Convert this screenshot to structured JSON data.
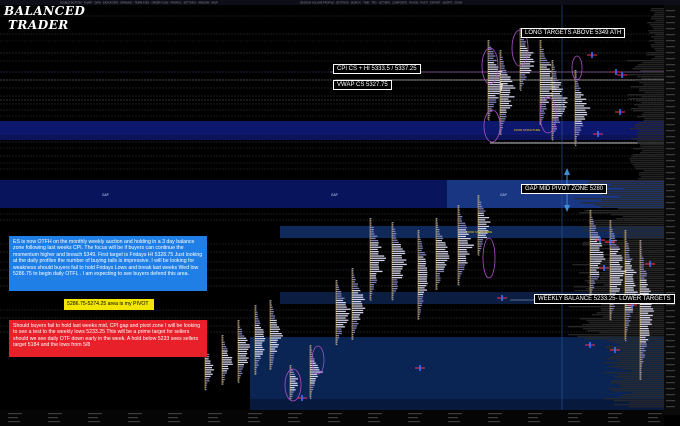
{
  "logo": {
    "line1": "BALANCED",
    "line2": "TRADER"
  },
  "labels": {
    "long_targets": "LONG  TARGETS ABOVE 5349 ATH",
    "cpi": "CPI  CS +  HI 5333.5 / 5337.25",
    "vwap": "VWAP CS   5327.75",
    "gap_mid": "GAP MID PIVOT ZONE 5280",
    "weekly_balance": "WEEKLY BALANCE 5233.25- LOWER TARGETS",
    "gap1": "GAP",
    "gap2": "GAP",
    "gap3": "GAP",
    "poor_structure_1": "POOR\nSTRUCTURE",
    "poor_structure_2": "POOR\nSTRUCTURE"
  },
  "notes": {
    "blue": "ES is now OTFH on  the monthly weekly auction and holding in a 3 day balance zone following last weeks CPI. The focus will be if buyers can continue the momentum  higher and breach 5349. First target is Fridays HI 5328.75  Just looking at the daily profiles the number of buying tails  is impressive. I will  be looking for weakness should buyers fail to hold Fridays Lows and break last weeks Wed low 5286.75 to begin daily OTFL .  I am expecting to see buyers defend this area.",
    "pivot": "5286.75-5274.25  area is my PIVOT",
    "red": "Should buyers fail to hold last weeks mid,  CPI gap and pivot zone I will be looking to see a  test  to the weekly  lows 5233.25  This will be  a prime target for sellers should we see daily OTF  down early in  the week.  A hold below 5233  sees sellers target 5184  and the lows  from  5/8"
  },
  "colors": {
    "blue_note": "#1f7fe6",
    "red_note": "#e8202a",
    "yellow_note": "#f2e600",
    "gap_band": "#0a1a6a",
    "value_area": "#1a3f7a"
  }
}
